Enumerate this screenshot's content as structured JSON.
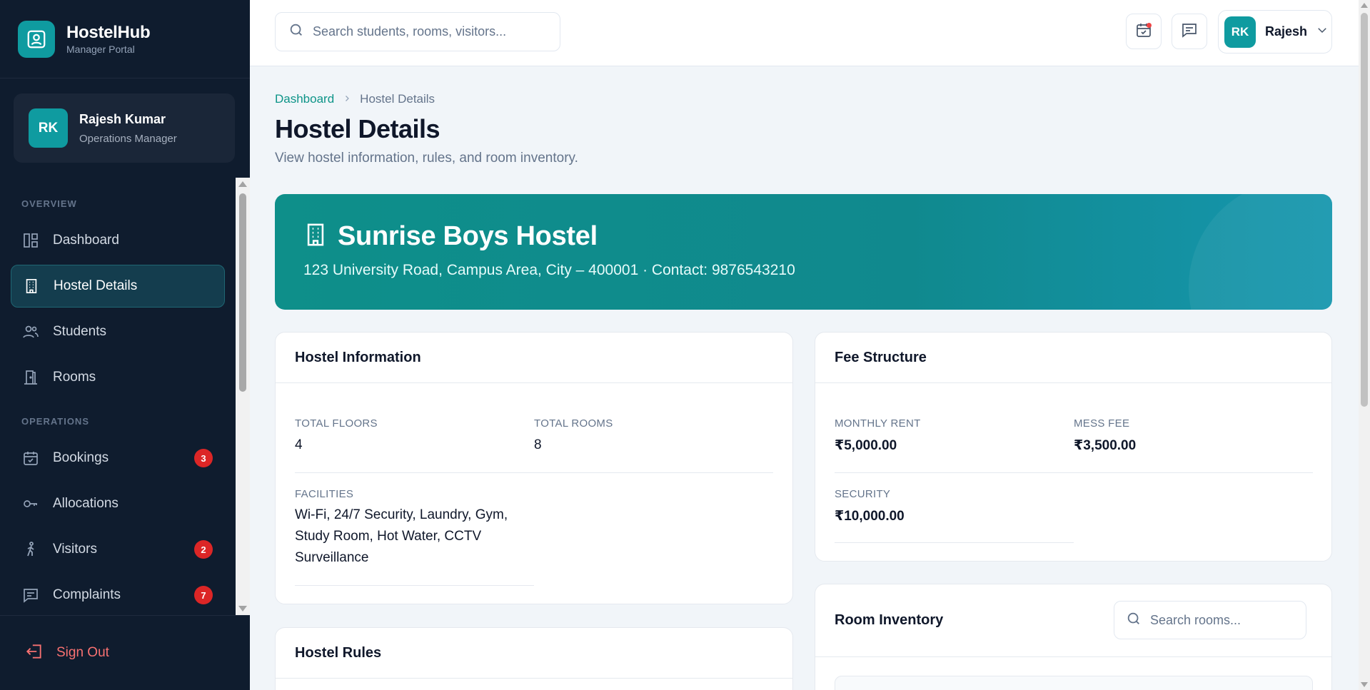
{
  "brand": {
    "name": "HostelHub",
    "subtitle": "Manager Portal"
  },
  "user": {
    "initials": "RK",
    "name": "Rajesh Kumar",
    "role": "Operations Manager"
  },
  "nav": {
    "overview_label": "OVERVIEW",
    "operations_label": "OPERATIONS",
    "items": [
      {
        "label": "Dashboard",
        "icon": "dashboard-icon"
      },
      {
        "label": "Hostel Details",
        "icon": "building-icon",
        "active": true
      },
      {
        "label": "Students",
        "icon": "users-icon"
      },
      {
        "label": "Rooms",
        "icon": "door-icon"
      },
      {
        "label": "Bookings",
        "icon": "calendar-check-icon",
        "badge": "3"
      },
      {
        "label": "Allocations",
        "icon": "key-icon"
      },
      {
        "label": "Visitors",
        "icon": "walking-person-icon",
        "badge": "2"
      },
      {
        "label": "Complaints",
        "icon": "message-icon",
        "badge": "7"
      }
    ],
    "signout_label": "Sign Out"
  },
  "topbar": {
    "search_placeholder": "Search students, rooms, visitors...",
    "profile_initials": "RK",
    "profile_name": "Rajesh"
  },
  "breadcrumb": {
    "root": "Dashboard",
    "current": "Hostel Details"
  },
  "page": {
    "title": "Hostel Details",
    "subtitle": "View hostel information, rules, and room inventory."
  },
  "hostel": {
    "name": "Sunrise Boys Hostel",
    "address_line": "123 University Road, Campus Area, City – 400001 · Contact: 9876543210"
  },
  "info_card": {
    "title": "Hostel Information",
    "floors_label": "TOTAL FLOORS",
    "floors_value": "4",
    "rooms_label": "TOTAL ROOMS",
    "rooms_value": "8",
    "facilities_label": "FACILITIES",
    "facilities_value": "Wi-Fi, 24/7 Security, Laundry, Gym, Study Room, Hot Water, CCTV Surveillance"
  },
  "fee_card": {
    "title": "Fee Structure",
    "rent_label": "MONTHLY RENT",
    "rent_value": "₹5,000.00",
    "mess_label": "MESS FEE",
    "mess_value": "₹3,500.00",
    "security_label": "SECURITY",
    "security_value": "₹10,000.00"
  },
  "rules_card": {
    "title": "Hostel Rules"
  },
  "inventory_card": {
    "title": "Room Inventory",
    "search_placeholder": "Search rooms..."
  },
  "colors": {
    "sidebar_bg": "#0f1c2e",
    "accent": "#0f9ba0",
    "link": "#0d9488",
    "badge": "#dc2626"
  }
}
